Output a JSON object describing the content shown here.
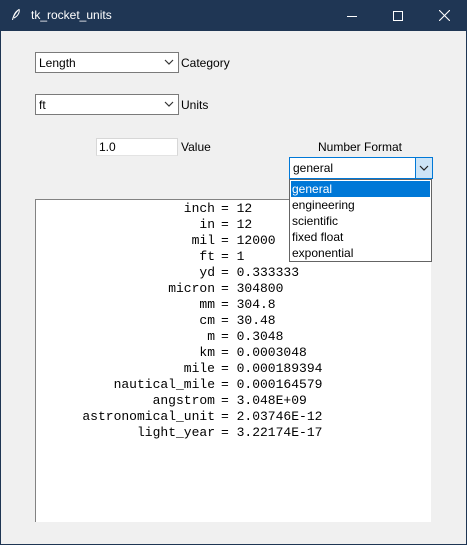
{
  "window": {
    "title": "tk_rocket_units"
  },
  "category": {
    "selected": "Length",
    "label": "Category"
  },
  "units": {
    "selected": "ft",
    "label": "Units"
  },
  "value": {
    "text": "1.0",
    "label": "Value"
  },
  "number_format": {
    "label": "Number Format",
    "selected": "general",
    "options": [
      "general",
      "engineering",
      "scientific",
      "fixed float",
      "exponential"
    ],
    "highlighted_index": 0
  },
  "results": [
    {
      "unit": "inch",
      "value": "12"
    },
    {
      "unit": "in",
      "value": "12"
    },
    {
      "unit": "mil",
      "value": "12000"
    },
    {
      "unit": "ft",
      "value": "1"
    },
    {
      "unit": "yd",
      "value": "0.333333"
    },
    {
      "unit": "micron",
      "value": "304800"
    },
    {
      "unit": "mm",
      "value": "304.8"
    },
    {
      "unit": "cm",
      "value": "30.48"
    },
    {
      "unit": "m",
      "value": "0.3048"
    },
    {
      "unit": "km",
      "value": "0.0003048"
    },
    {
      "unit": "mile",
      "value": "0.000189394"
    },
    {
      "unit": "nautical_mile",
      "value": "0.000164579"
    },
    {
      "unit": "angstrom",
      "value": "3.048E+09"
    },
    {
      "unit": "astronomical_unit",
      "value": "2.03746E-12"
    },
    {
      "unit": "light_year",
      "value": "3.22174E-17"
    }
  ],
  "icons": {
    "app": "feather-icon",
    "minimize": "minimize-icon",
    "maximize": "maximize-icon",
    "close": "close-icon",
    "dropdown": "chevron-down-icon"
  },
  "colors": {
    "titlebar": "#1f3654",
    "accent": "#0078d7",
    "client_bg": "#f0f0f0"
  }
}
